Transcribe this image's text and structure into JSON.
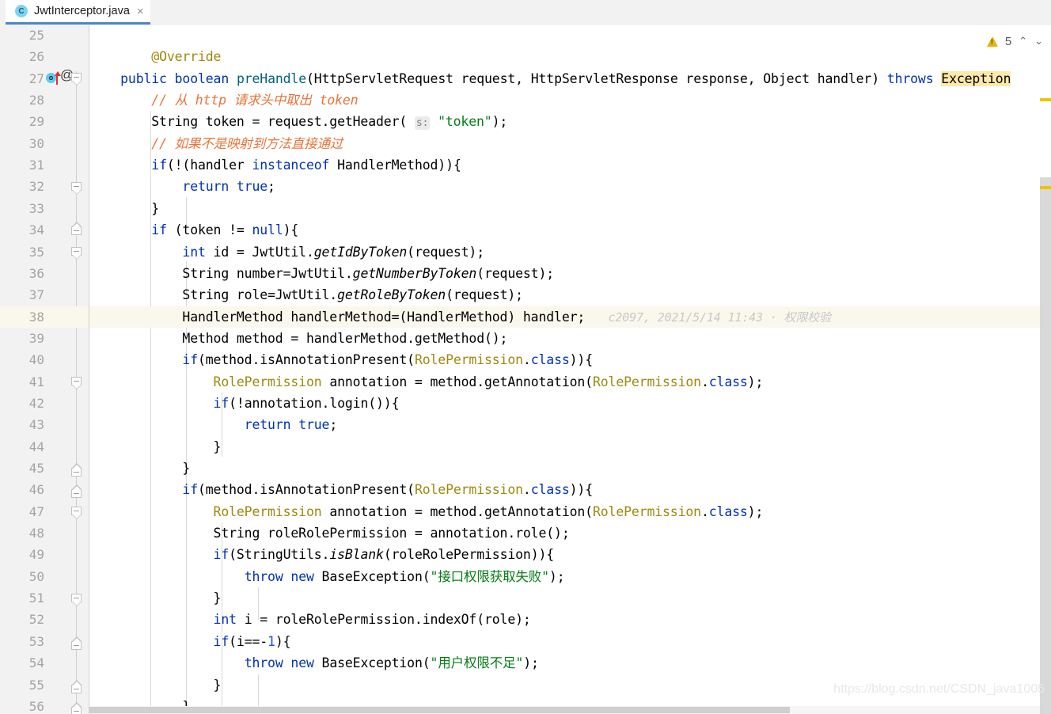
{
  "tab": {
    "icon": "java-class-icon",
    "icon_letter": "C",
    "title": "JwtInterceptor.java",
    "close": "×"
  },
  "inspections": {
    "warning_count": "5",
    "up_chevron": "⌃",
    "down_chevron": "⌄"
  },
  "watermark": "https://blog.csdn.net/CSDN_java1005",
  "blame": {
    "author": "c2097",
    "datetime": "2021/5/14 11:43",
    "separator": "·",
    "message": "权限校验",
    "full": "c2097, 2021/5/14 11:43 · 权限校验"
  },
  "editor": {
    "first_visible_line": "25",
    "last_visible_line": "56",
    "caret_line": "38",
    "lines": [
      {
        "n": "25",
        "text": ""
      },
      {
        "n": "26",
        "text": "        @Override"
      },
      {
        "n": "27",
        "text": "    public boolean preHandle(HttpServletRequest request, HttpServletResponse response, Object handler) throws Exception"
      },
      {
        "n": "28",
        "text": "        // 从 http 请求头中取出 token"
      },
      {
        "n": "29",
        "text": "        String token = request.getHeader( s: \"token\");"
      },
      {
        "n": "30",
        "text": "        // 如果不是映射到方法直接通过"
      },
      {
        "n": "31",
        "text": "        if(!(handler instanceof HandlerMethod)){"
      },
      {
        "n": "32",
        "text": "            return true;"
      },
      {
        "n": "33",
        "text": "        }"
      },
      {
        "n": "34",
        "text": "        if (token != null){"
      },
      {
        "n": "35",
        "text": "            int id = JwtUtil.getIdByToken(request);"
      },
      {
        "n": "36",
        "text": "            String number=JwtUtil.getNumberByToken(request);"
      },
      {
        "n": "37",
        "text": "            String role=JwtUtil.getRoleByToken(request);"
      },
      {
        "n": "38",
        "text": "            HandlerMethod handlerMethod=(HandlerMethod) handler;"
      },
      {
        "n": "39",
        "text": "            Method method = handlerMethod.getMethod();"
      },
      {
        "n": "40",
        "text": "            if(method.isAnnotationPresent(RolePermission.class)){"
      },
      {
        "n": "41",
        "text": "                RolePermission annotation = method.getAnnotation(RolePermission.class);"
      },
      {
        "n": "42",
        "text": "                if(!annotation.login()){"
      },
      {
        "n": "43",
        "text": "                    return true;"
      },
      {
        "n": "44",
        "text": "                }"
      },
      {
        "n": "45",
        "text": "            }"
      },
      {
        "n": "46",
        "text": "            if(method.isAnnotationPresent(RolePermission.class)){"
      },
      {
        "n": "47",
        "text": "                RolePermission annotation = method.getAnnotation(RolePermission.class);"
      },
      {
        "n": "48",
        "text": "                String roleRolePermission = annotation.role();"
      },
      {
        "n": "49",
        "text": "                if(StringUtils.isBlank(roleRolePermission)){"
      },
      {
        "n": "50",
        "text": "                    throw new BaseException(\"接口权限获取失败\");"
      },
      {
        "n": "51",
        "text": "                }"
      },
      {
        "n": "52",
        "text": "                int i = roleRolePermission.indexOf(role);"
      },
      {
        "n": "53",
        "text": "                if(i==-1){"
      },
      {
        "n": "54",
        "text": "                    throw new BaseException(\"用户权限不足\");"
      },
      {
        "n": "55",
        "text": "                }"
      },
      {
        "n": "56",
        "text": "            }"
      }
    ],
    "parameter_hint": "s:",
    "gutter_icons": {
      "line27_implements": "o",
      "line27_annotation": "@"
    }
  },
  "colors": {
    "keyword": "#0033b3",
    "annotation": "#9e880d",
    "method": "#00627a",
    "comment": "#e8743b",
    "string": "#067d17",
    "number": "#1750eb",
    "caret_line_bg": "#faf8ec",
    "gutter_bg": "#f2f2f2",
    "tab_underline": "#4a86c8",
    "warning": "#eec20b"
  }
}
